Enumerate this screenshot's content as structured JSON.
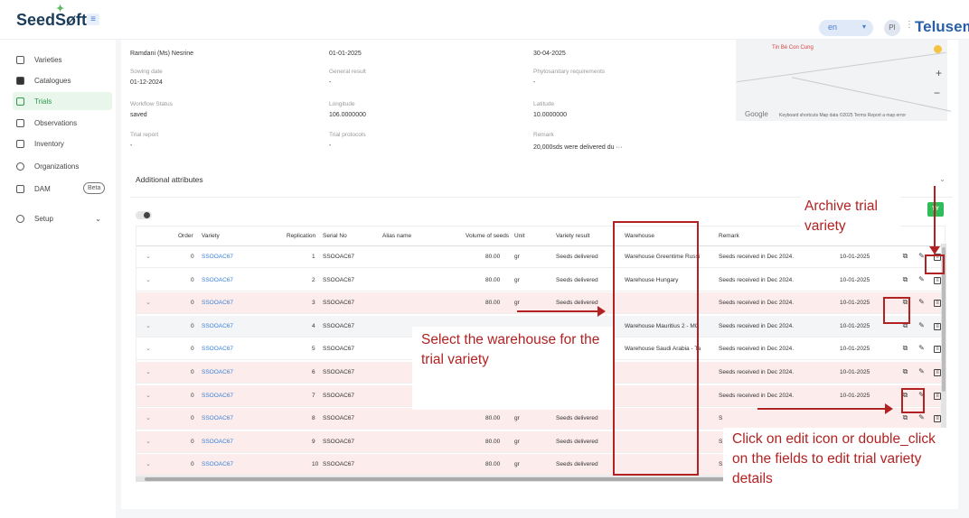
{
  "header": {
    "logo": "SeedSøft",
    "menu_icon": "≡",
    "lang": "en",
    "user_initials": "PI",
    "kebab": "⋮",
    "partner_logo": "Telusem"
  },
  "sidebar": {
    "items": [
      {
        "label": "Varieties",
        "icon": "grid-icon"
      },
      {
        "label": "Catalogues",
        "icon": "book-icon"
      },
      {
        "label": "Trials",
        "icon": "trial-icon"
      },
      {
        "label": "Observations",
        "icon": "clipboard-icon"
      },
      {
        "label": "Inventory",
        "icon": "warehouse-icon"
      },
      {
        "label": "Organizations",
        "icon": "org-icon"
      },
      {
        "label": "DAM",
        "icon": "folder-icon",
        "badge": "Beta"
      },
      {
        "label": "Setup",
        "icon": "gear-icon"
      }
    ]
  },
  "details": {
    "owner": "Ramdani (Ms) Nesrine",
    "start_date": "01-01-2025",
    "end_date": "30-04-2025",
    "sowing_label": "Sowing date",
    "sowing": "01-12-2024",
    "general_label": "General result",
    "general": "-",
    "phyto_label": "Phytosanitary requirements",
    "phyto": "-",
    "workflow_label": "Workflow Status",
    "workflow": "saved",
    "longitude_label": "Longitude",
    "longitude": "106.0000000",
    "latitude_label": "Latitude",
    "latitude": "10.0000000",
    "report_label": "Trial report",
    "report": "-",
    "protocols_label": "Trial protocols",
    "protocols": "-",
    "remark_label": "Remark",
    "remark": "20,000sds were delivered du  ···"
  },
  "map": {
    "place": "Tin Bé Con Cung",
    "plus": "+",
    "minus": "−",
    "google": "Google",
    "attribution": "Keyboard shortcuts  Map data ©2025  Terms  Report a map error"
  },
  "section": {
    "title": "Additional attributes",
    "add_btn": "TY"
  },
  "table": {
    "headers": [
      "Order",
      "Variety",
      "Replication",
      "Serial No",
      "Alias name",
      "Volume of seeds",
      "Unit",
      "Variety result",
      "Warehouse",
      "Remark"
    ],
    "rows": [
      {
        "order": "0",
        "variety": "SSOOAC67",
        "rep": "1",
        "serial": "SSOOAC67",
        "volume": "80.00",
        "unit": "gr",
        "result": "Seeds delivered",
        "warehouse": "Warehouse Greentime Russi",
        "remark": "Seeds received in Dec 2024.",
        "date": "10-01-2025",
        "style": "white"
      },
      {
        "order": "0",
        "variety": "SSOOAC67",
        "rep": "2",
        "serial": "SSOOAC67",
        "volume": "80.00",
        "unit": "gr",
        "result": "Seeds delivered",
        "warehouse": "Warehouse Hungary",
        "remark": "Seeds received in Dec 2024.",
        "date": "10-01-2025",
        "style": "white"
      },
      {
        "order": "0",
        "variety": "SSOOAC67",
        "rep": "3",
        "serial": "SSOOAC67",
        "volume": "80.00",
        "unit": "gr",
        "result": "Seeds delivered",
        "warehouse": "",
        "remark": "Seeds received in Dec 2024.",
        "date": "10-01-2025",
        "style": "pink"
      },
      {
        "order": "0",
        "variety": "SSOOAC67",
        "rep": "4",
        "serial": "SSOOAC67",
        "volume": "",
        "unit": "",
        "result": "",
        "warehouse": "Warehouse Mauritius 2 - MC",
        "remark": "Seeds received in Dec 2024.",
        "date": "10-01-2025",
        "style": "gray"
      },
      {
        "order": "0",
        "variety": "SSOOAC67",
        "rep": "5",
        "serial": "SSOOAC67",
        "volume": "",
        "unit": "",
        "result": "",
        "warehouse": "Warehouse Saudi Arabia - Ta",
        "remark": "Seeds received in Dec 2024.",
        "date": "10-01-2025",
        "style": "white"
      },
      {
        "order": "0",
        "variety": "SSOOAC67",
        "rep": "6",
        "serial": "SSOOAC67",
        "volume": "",
        "unit": "",
        "result": "",
        "warehouse": "",
        "remark": "Seeds received in Dec 2024.",
        "date": "10-01-2025",
        "style": "pink"
      },
      {
        "order": "0",
        "variety": "SSOOAC67",
        "rep": "7",
        "serial": "SSOOAC67",
        "volume": "",
        "unit": "",
        "result": "",
        "warehouse": "",
        "remark": "Seeds received in Dec 2024.",
        "date": "10-01-2025",
        "style": "pink"
      },
      {
        "order": "0",
        "variety": "SSOOAC67",
        "rep": "8",
        "serial": "SSOOAC67",
        "volume": "80.00",
        "unit": "gr",
        "result": "Seeds delivered",
        "warehouse": "",
        "remark": "S",
        "date": "",
        "style": "pink"
      },
      {
        "order": "0",
        "variety": "SSOOAC67",
        "rep": "9",
        "serial": "SSOOAC67",
        "volume": "80.00",
        "unit": "gr",
        "result": "Seeds delivered",
        "warehouse": "",
        "remark": "S",
        "date": "",
        "style": "pink"
      },
      {
        "order": "0",
        "variety": "SSOOAC67",
        "rep": "10",
        "serial": "SSOOAC67",
        "volume": "80.00",
        "unit": "gr",
        "result": "Seeds delivered",
        "warehouse": "",
        "remark": "S",
        "date": "",
        "style": "pink"
      }
    ]
  },
  "annotations": {
    "archive": "Archive trial variety",
    "select": "Select the warehouse for the trial variety",
    "edit": "Click on edit icon or double_click on the fields to edit trial variety details"
  }
}
